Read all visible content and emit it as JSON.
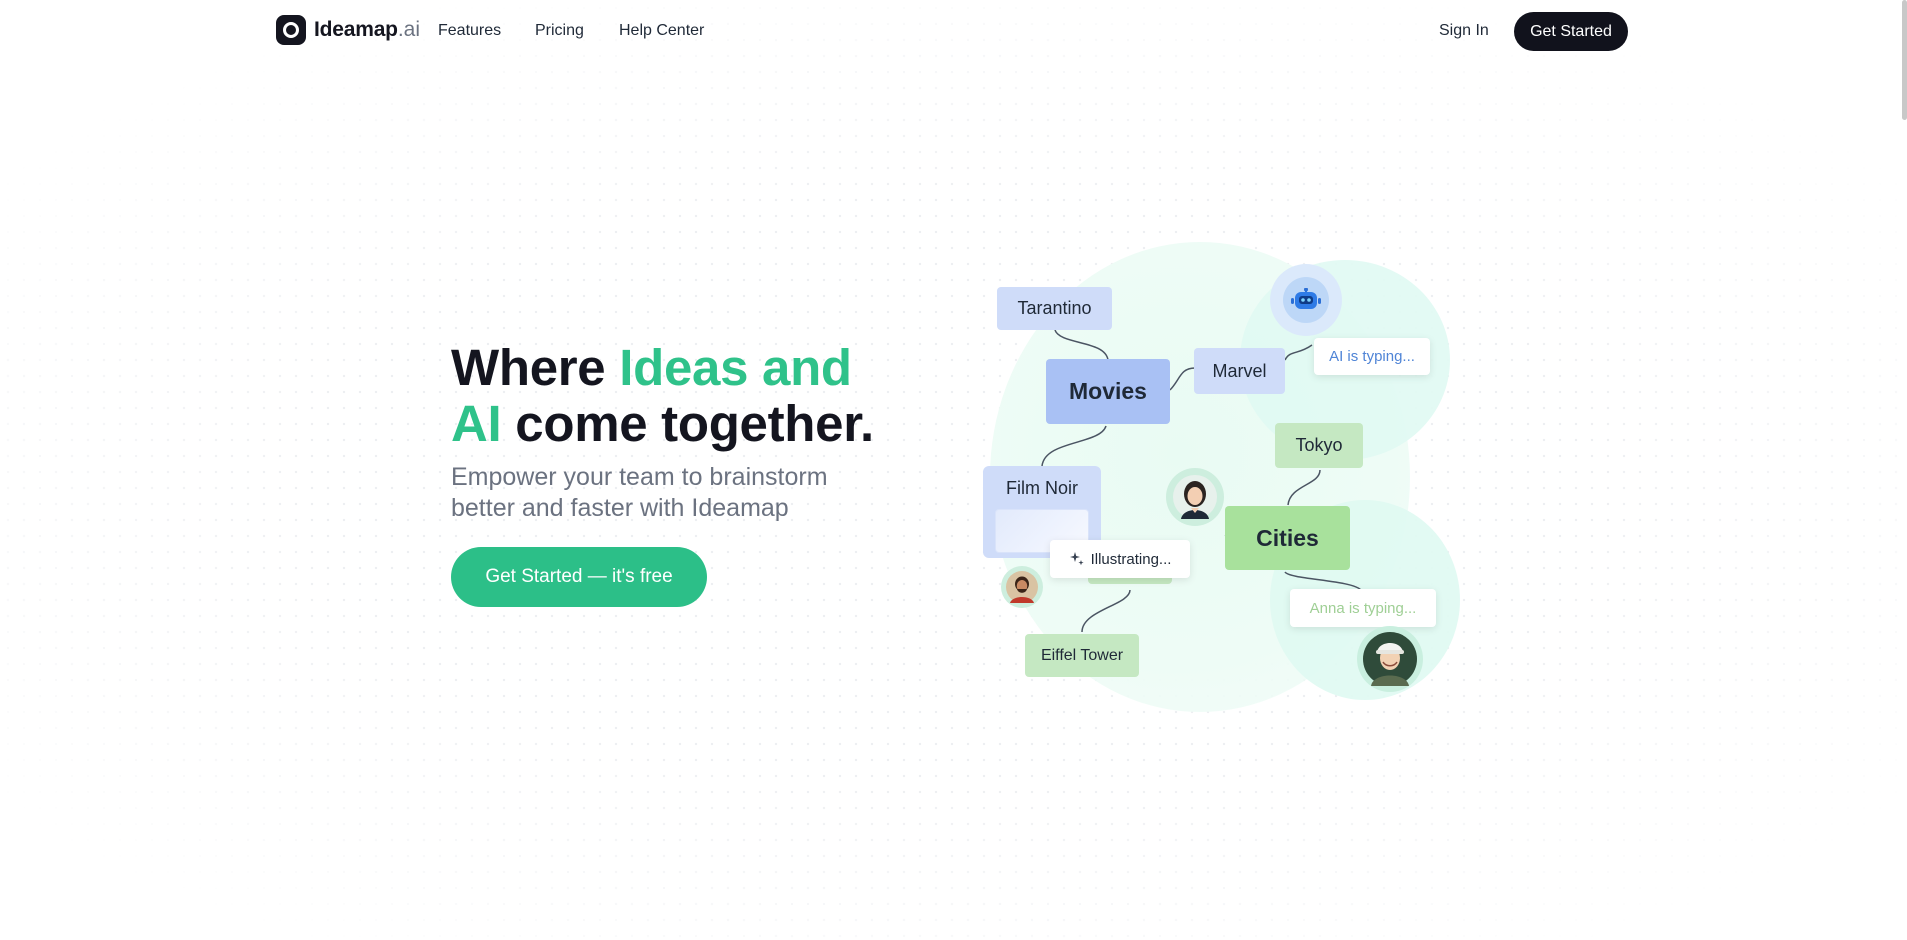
{
  "nav": {
    "brand": "Ideamap",
    "brand_tld": ".ai",
    "links": [
      "Features",
      "Pricing",
      "Help Center"
    ],
    "sign_in": "Sign In",
    "get_started": "Get Started"
  },
  "hero": {
    "headline_1": "Where ",
    "headline_2": "Ideas and",
    "headline_3": "AI",
    "headline_4": " come together.",
    "subtitle": "Empower your team to brainstorm better and faster with Ideamap",
    "cta": "Get Started — it's free"
  },
  "mindmap": {
    "nodes": {
      "tarantino": "Tarantino",
      "movies": "Movies",
      "marvel": "Marvel",
      "film_noir": "Film Noir",
      "tokyo": "Tokyo",
      "cities": "Cities",
      "eiffel": "Eiffel Tower"
    },
    "ai_typing": "AI is typing...",
    "illustrating": "Illustrating...",
    "anna_typing": "Anna is typing..."
  },
  "colors": {
    "accent_green": "#2cbf88",
    "dark": "#11121c",
    "node_blue": "#a9c1f4",
    "node_green": "#a8e19c"
  },
  "icons": {
    "logo": "logo-ring-icon",
    "robot": "robot-icon",
    "sparkle": "sparkle-icon"
  }
}
